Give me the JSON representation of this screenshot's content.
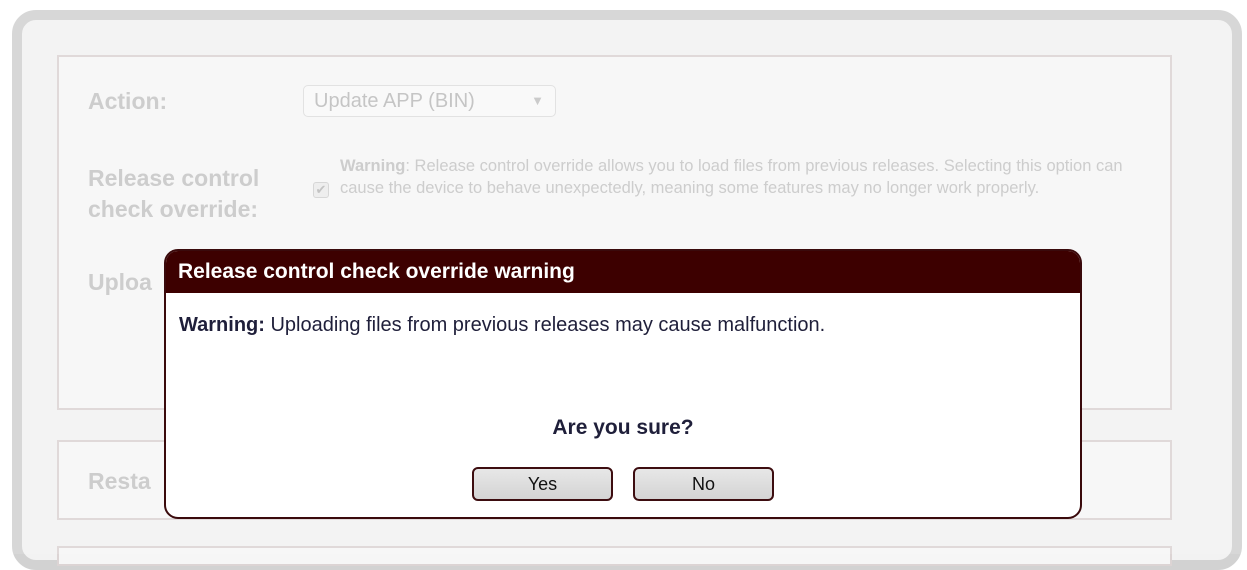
{
  "form": {
    "action_label": "Action:",
    "action_value": "Update APP (BIN)",
    "action_caret": "▼",
    "release_label_line1": "Release control",
    "release_label_line2": "check override:",
    "checkbox_checked": true,
    "checkbox_mark": "✔",
    "warning_bold": "Warning",
    "warning_rest": ": Release control override allows you to load files from previous releases. Selecting this option can cause the device to behave unexpectedly, meaning some features may no longer work properly.",
    "upload_label": "Uploa",
    "restart_label": "Resta"
  },
  "dialog": {
    "title": "Release control check override warning",
    "message_bold": "Warning:",
    "message_rest": " Uploading files from previous releases may cause malfunction.",
    "question": "Are you sure?",
    "yes_label": "Yes",
    "no_label": "No"
  },
  "colors": {
    "dialog_header": "#3d0000",
    "dialog_border": "#3a0a0c",
    "disabled_text": "#c6c6c6"
  }
}
